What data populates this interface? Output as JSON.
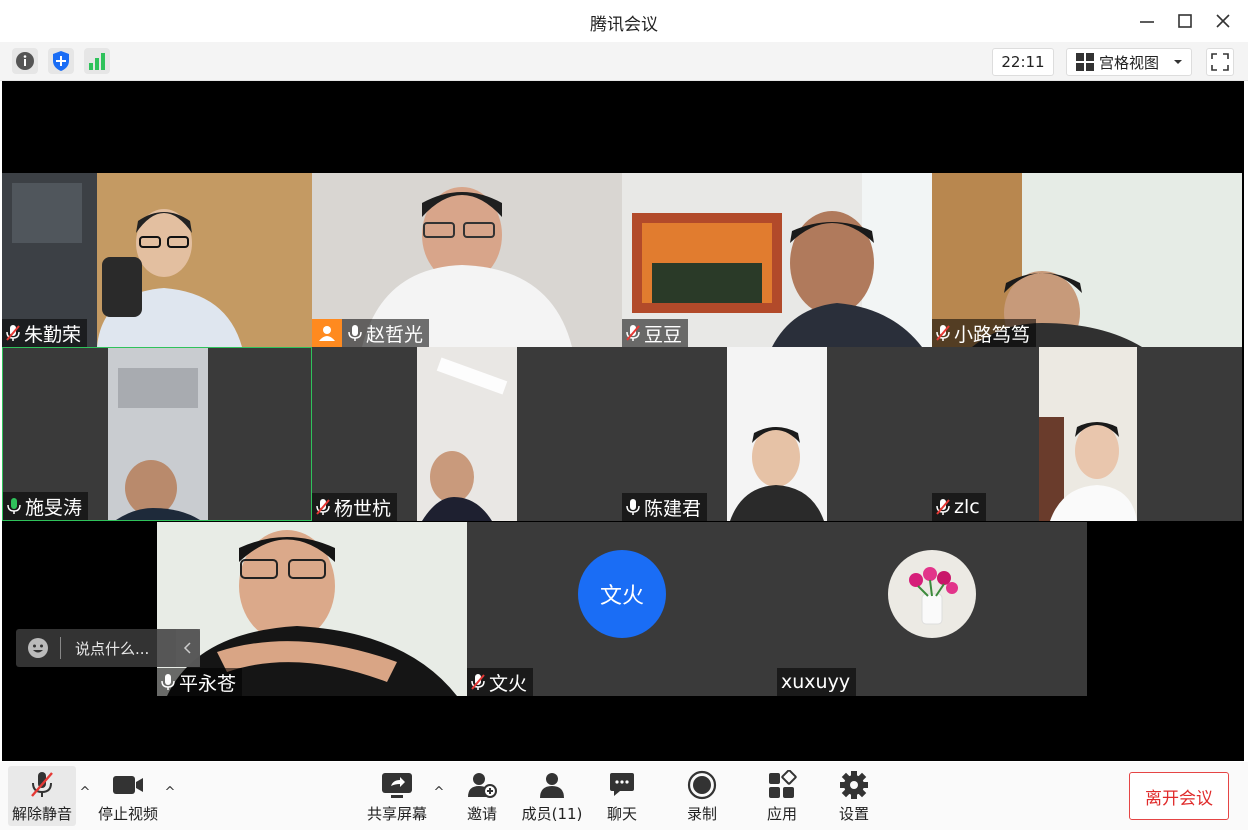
{
  "window": {
    "title": "腾讯会议"
  },
  "toolbar": {
    "time": "22:11",
    "view_label": "宫格视图"
  },
  "participants": [
    {
      "name": "朱勤荣",
      "mic": "muted"
    },
    {
      "name": "赵哲光",
      "mic": "on"
    },
    {
      "name": "豆豆",
      "mic": "muted"
    },
    {
      "name": "小路笃笃",
      "mic": "muted"
    },
    {
      "name": "施旻涛",
      "mic": "speaking"
    },
    {
      "name": "杨世杭",
      "mic": "muted"
    },
    {
      "name": "陈建君",
      "mic": "on"
    },
    {
      "name": "zlc",
      "mic": "muted"
    },
    {
      "name": "平永苍",
      "mic": "on"
    },
    {
      "name": "文火",
      "mic": "muted",
      "avatar_text": "文火"
    },
    {
      "name": "xuxuyy",
      "mic": "none"
    }
  ],
  "chat": {
    "placeholder": "说点什么..."
  },
  "bottombar": {
    "unmute": "解除静音",
    "stop_video": "停止视频",
    "share_screen": "共享屏幕",
    "invite": "邀请",
    "members": "成员(11)",
    "chat": "聊天",
    "record": "录制",
    "apps": "应用",
    "settings": "设置",
    "leave": "离开会议"
  },
  "colors": {
    "accent": "#1a6df5",
    "leave": "#e02b2b",
    "speaking": "#2fc25b",
    "badge": "#ff8a1f"
  }
}
